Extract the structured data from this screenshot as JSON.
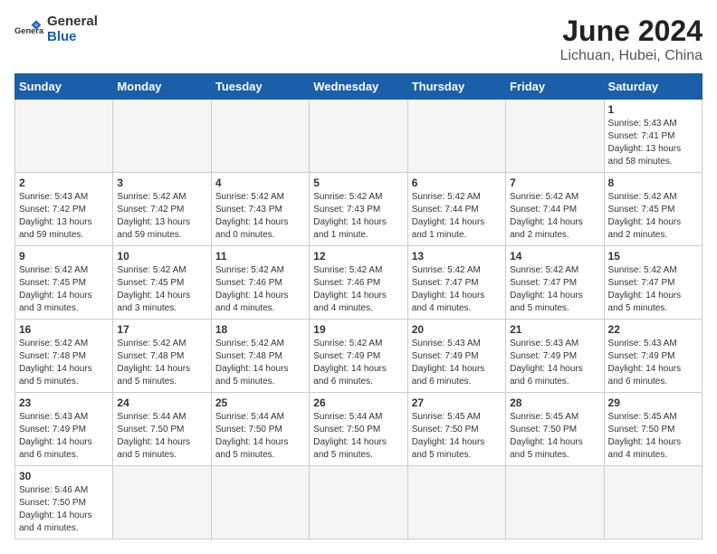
{
  "header": {
    "logo_general": "General",
    "logo_blue": "Blue",
    "month_year": "June 2024",
    "location": "Lichuan, Hubei, China"
  },
  "days_of_week": [
    "Sunday",
    "Monday",
    "Tuesday",
    "Wednesday",
    "Thursday",
    "Friday",
    "Saturday"
  ],
  "weeks": [
    [
      {
        "day": null,
        "info": null
      },
      {
        "day": null,
        "info": null
      },
      {
        "day": null,
        "info": null
      },
      {
        "day": null,
        "info": null
      },
      {
        "day": null,
        "info": null
      },
      {
        "day": null,
        "info": null
      },
      {
        "day": "1",
        "info": "Sunrise: 5:43 AM\nSunset: 7:41 PM\nDaylight: 13 hours\nand 58 minutes."
      }
    ],
    [
      {
        "day": "2",
        "info": "Sunrise: 5:43 AM\nSunset: 7:42 PM\nDaylight: 13 hours\nand 59 minutes."
      },
      {
        "day": "3",
        "info": "Sunrise: 5:42 AM\nSunset: 7:42 PM\nDaylight: 13 hours\nand 59 minutes."
      },
      {
        "day": "4",
        "info": "Sunrise: 5:42 AM\nSunset: 7:43 PM\nDaylight: 14 hours\nand 0 minutes."
      },
      {
        "day": "5",
        "info": "Sunrise: 5:42 AM\nSunset: 7:43 PM\nDaylight: 14 hours\nand 1 minute."
      },
      {
        "day": "6",
        "info": "Sunrise: 5:42 AM\nSunset: 7:44 PM\nDaylight: 14 hours\nand 1 minute."
      },
      {
        "day": "7",
        "info": "Sunrise: 5:42 AM\nSunset: 7:44 PM\nDaylight: 14 hours\nand 2 minutes."
      },
      {
        "day": "8",
        "info": "Sunrise: 5:42 AM\nSunset: 7:45 PM\nDaylight: 14 hours\nand 2 minutes."
      }
    ],
    [
      {
        "day": "9",
        "info": "Sunrise: 5:42 AM\nSunset: 7:45 PM\nDaylight: 14 hours\nand 3 minutes."
      },
      {
        "day": "10",
        "info": "Sunrise: 5:42 AM\nSunset: 7:45 PM\nDaylight: 14 hours\nand 3 minutes."
      },
      {
        "day": "11",
        "info": "Sunrise: 5:42 AM\nSunset: 7:46 PM\nDaylight: 14 hours\nand 4 minutes."
      },
      {
        "day": "12",
        "info": "Sunrise: 5:42 AM\nSunset: 7:46 PM\nDaylight: 14 hours\nand 4 minutes."
      },
      {
        "day": "13",
        "info": "Sunrise: 5:42 AM\nSunset: 7:47 PM\nDaylight: 14 hours\nand 4 minutes."
      },
      {
        "day": "14",
        "info": "Sunrise: 5:42 AM\nSunset: 7:47 PM\nDaylight: 14 hours\nand 5 minutes."
      },
      {
        "day": "15",
        "info": "Sunrise: 5:42 AM\nSunset: 7:47 PM\nDaylight: 14 hours\nand 5 minutes."
      }
    ],
    [
      {
        "day": "16",
        "info": "Sunrise: 5:42 AM\nSunset: 7:48 PM\nDaylight: 14 hours\nand 5 minutes."
      },
      {
        "day": "17",
        "info": "Sunrise: 5:42 AM\nSunset: 7:48 PM\nDaylight: 14 hours\nand 5 minutes."
      },
      {
        "day": "18",
        "info": "Sunrise: 5:42 AM\nSunset: 7:48 PM\nDaylight: 14 hours\nand 5 minutes."
      },
      {
        "day": "19",
        "info": "Sunrise: 5:42 AM\nSunset: 7:49 PM\nDaylight: 14 hours\nand 6 minutes."
      },
      {
        "day": "20",
        "info": "Sunrise: 5:43 AM\nSunset: 7:49 PM\nDaylight: 14 hours\nand 6 minutes."
      },
      {
        "day": "21",
        "info": "Sunrise: 5:43 AM\nSunset: 7:49 PM\nDaylight: 14 hours\nand 6 minutes."
      },
      {
        "day": "22",
        "info": "Sunrise: 5:43 AM\nSunset: 7:49 PM\nDaylight: 14 hours\nand 6 minutes."
      }
    ],
    [
      {
        "day": "23",
        "info": "Sunrise: 5:43 AM\nSunset: 7:49 PM\nDaylight: 14 hours\nand 6 minutes."
      },
      {
        "day": "24",
        "info": "Sunrise: 5:44 AM\nSunset: 7:50 PM\nDaylight: 14 hours\nand 5 minutes."
      },
      {
        "day": "25",
        "info": "Sunrise: 5:44 AM\nSunset: 7:50 PM\nDaylight: 14 hours\nand 5 minutes."
      },
      {
        "day": "26",
        "info": "Sunrise: 5:44 AM\nSunset: 7:50 PM\nDaylight: 14 hours\nand 5 minutes."
      },
      {
        "day": "27",
        "info": "Sunrise: 5:45 AM\nSunset: 7:50 PM\nDaylight: 14 hours\nand 5 minutes."
      },
      {
        "day": "28",
        "info": "Sunrise: 5:45 AM\nSunset: 7:50 PM\nDaylight: 14 hours\nand 5 minutes."
      },
      {
        "day": "29",
        "info": "Sunrise: 5:45 AM\nSunset: 7:50 PM\nDaylight: 14 hours\nand 4 minutes."
      }
    ],
    [
      {
        "day": "30",
        "info": "Sunrise: 5:46 AM\nSunset: 7:50 PM\nDaylight: 14 hours\nand 4 minutes."
      },
      {
        "day": null,
        "info": null
      },
      {
        "day": null,
        "info": null
      },
      {
        "day": null,
        "info": null
      },
      {
        "day": null,
        "info": null
      },
      {
        "day": null,
        "info": null
      },
      {
        "day": null,
        "info": null
      }
    ]
  ]
}
